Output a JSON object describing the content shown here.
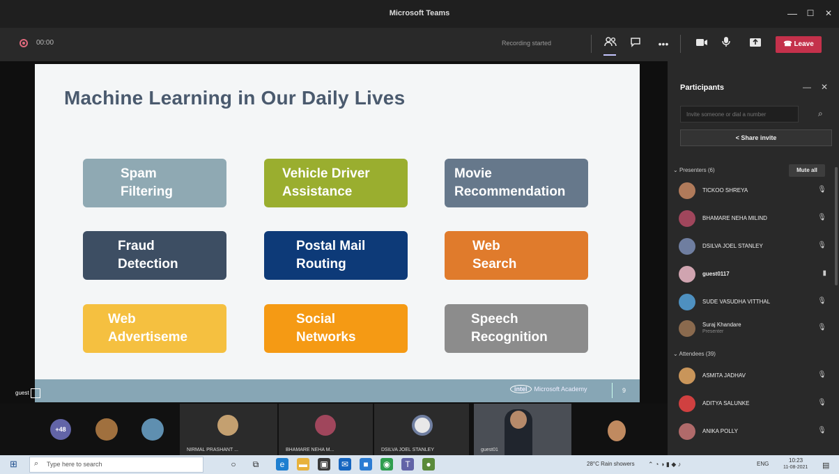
{
  "window": {
    "title": "Microsoft Teams",
    "minimize": "—",
    "maximize": "☐",
    "close": "✕"
  },
  "meeting_toolbar": {
    "timer": "00:00",
    "status_text": "Recording started",
    "icons": [
      "people-icon",
      "chat-icon",
      "more-icon",
      "camera-icon",
      "mic-icon",
      "share-icon"
    ],
    "leave_label": "Leave",
    "leave_color": "#c4314b"
  },
  "slide": {
    "title": "Machine Learning in Our Daily Lives",
    "cards": [
      {
        "line1": "Spam",
        "line2": "Filtering",
        "color": "#8fa9b3"
      },
      {
        "line1": "Vehicle Driver",
        "line2": "Assistance",
        "color": "#9aae2f"
      },
      {
        "line1": "Movie",
        "line2": "Recommendation",
        "color": "#66788b"
      },
      {
        "line1": "Fraud",
        "line2": "Detection",
        "color": "#3d4e63"
      },
      {
        "line1": "Postal Mail",
        "line2": "Routing",
        "color": "#0d3a78"
      },
      {
        "line1": "Web",
        "line2": "Search",
        "color": "#e07b2c"
      },
      {
        "line1": "Web",
        "line2": "Advertiseme",
        "color": "#f5c040"
      },
      {
        "line1": "Social",
        "line2": "Networks",
        "color": "#f59a14"
      },
      {
        "line1": "Speech",
        "line2": "Recognition",
        "color": "#8c8c8c"
      }
    ],
    "footer_logo": "intel",
    "footer_text": "Microsoft Academy",
    "footer_page": "9",
    "presenter_tag": "guest"
  },
  "video_strip": {
    "more_count": "+48",
    "tiles": [
      {
        "name": "NIRMAL PRASHANT ..."
      },
      {
        "name": "BHAMARE NEHA M..."
      },
      {
        "name": "DSILVA JOEL STANLEY"
      },
      {
        "name": "guest01"
      }
    ]
  },
  "participants": {
    "title": "Participants",
    "invite_placeholder": "Invite someone or dial a number",
    "share_label": "Share invite",
    "presenters_label": "Presenters (6)",
    "mute_all": "Mute all",
    "presenters": [
      {
        "name": "TICKOO SHREYA",
        "color": "#b07a5a",
        "sub": ""
      },
      {
        "name": "BHAMARE NEHA MILIND",
        "color": "#a0465c",
        "sub": ""
      },
      {
        "name": "DSILVA JOEL STANLEY",
        "color": "#6f7ea0",
        "sub": ""
      },
      {
        "name": "guest0117",
        "color": "#d0a4b0",
        "sub": ""
      },
      {
        "name": "SUDE VASUDHA VITTHAL",
        "color": "#4e90c0",
        "sub": ""
      },
      {
        "name": "Suraj Khandare",
        "color": "#8a6a4e",
        "sub": "Presenter"
      }
    ],
    "attendees_label": "Attendees (39)",
    "attendees": [
      {
        "name": "ASMITA JADHAV",
        "color": "#c9955a"
      },
      {
        "name": "ADITYA SALUNKE",
        "color": "#d04040"
      },
      {
        "name": "ANIKA POLLY",
        "color": "#b06a6a"
      }
    ]
  },
  "taskbar": {
    "search_placeholder": "Type here to search",
    "weather": "28°C Rain showers",
    "lang": "ENG",
    "time": "10:23",
    "date": "11-08-2021"
  }
}
